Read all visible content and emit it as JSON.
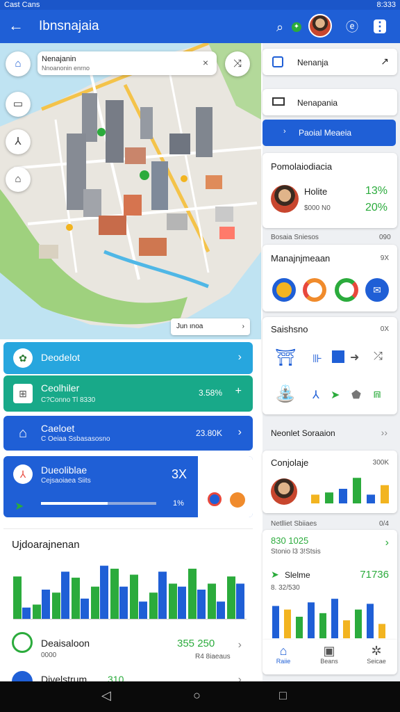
{
  "status_bar": {
    "carrier": "Cast Cans",
    "time": "8:333"
  },
  "app_bar": {
    "back_glyph": "←",
    "title": "Ibnsnajaia",
    "search_glyph": "⌕",
    "sync_glyph": "✦",
    "share_glyph": "ⓔ",
    "menu_glyph": "⋮"
  },
  "map": {
    "search": {
      "title": "Nenajanin",
      "subtitle": "Nnoanonin enrno",
      "close_glyph": "×"
    },
    "route_glyph": "⤨",
    "side_buttons": [
      "⌂",
      "▭",
      "⅄",
      "⌂"
    ],
    "scale": {
      "text": "Jun ınoa",
      "chevron": "›"
    }
  },
  "right_panel": {
    "dest1": "Nenanja",
    "dest2": "Nenapania",
    "primary_button": "Paoial Meaeia",
    "profile_card": {
      "title": "Pomolaiodiacia",
      "name": "Holite",
      "name_pct": "13%",
      "sub": "$000 N0",
      "sub_pct": "20%"
    },
    "section1": {
      "label": "Bosaia Sniesos",
      "value": "090"
    },
    "manage": {
      "title": "Manajnjmeaan",
      "badge": "9X"
    },
    "saisheno": {
      "title": "Saishsno",
      "badge": "0X"
    },
    "link_row": {
      "label": "Neonlet Soraaion",
      "chev": "››"
    },
    "conjolaje": {
      "title": "Conjolaje",
      "badge": "300K"
    },
    "stat_header": {
      "label": "Netlliet Sbiiaes",
      "value": "0/4"
    },
    "stat1": {
      "value": "830 1025",
      "sub": "Stonio l3 3!Stsis"
    },
    "stat2": {
      "label": "Slelme",
      "value": "71736",
      "sub": "8. 32/530"
    },
    "tabs": [
      {
        "glyph": "⌂",
        "label": "Raiie"
      },
      {
        "glyph": "▣",
        "label": "Beans"
      },
      {
        "glyph": "✲",
        "label": "Seicae"
      }
    ]
  },
  "drawer": {
    "item1": {
      "label": "Deodelot"
    },
    "item2": {
      "label": "Ceolhiler",
      "sub": "C?Conno Tl 8330",
      "value": "3.58%",
      "action": "+"
    },
    "item3": {
      "label": "Caeloet",
      "sub": "C Oeiaa Ssbasasosno",
      "value": "23.80K"
    },
    "item4": {
      "label": "Dueoliblae",
      "sub": "Cejsaoiaea Siits",
      "value": "3X",
      "progress_pct": "1%",
      "progress": 0.58
    }
  },
  "bottom": {
    "title": "Ujdoarajnenan",
    "row1": {
      "label": "Deaisaloon",
      "sub": "0000",
      "value": "355 250",
      "sub2": "R4 8iaeaus"
    },
    "row2": {
      "label": "Divelstrum",
      "value": "310"
    }
  },
  "chart_main": {
    "type": "bar",
    "series": [
      {
        "color": "#2bab3c",
        "values": [
          72,
          25,
          45,
          70,
          55,
          85,
          75,
          45,
          60,
          85,
          60,
          72
        ]
      },
      {
        "color": "#1f5fd6",
        "values": [
          20,
          50,
          80,
          35,
          90,
          55,
          30,
          80,
          55,
          50,
          30,
          60
        ]
      }
    ]
  },
  "chart_small": {
    "type": "bar",
    "values": [
      {
        "v": 12,
        "c": "#f2b420"
      },
      {
        "v": 15,
        "c": "#2bab3c"
      },
      {
        "v": 20,
        "c": "#1f5fd6"
      },
      {
        "v": 35,
        "c": "#2bab3c"
      },
      {
        "v": 12,
        "c": "#1f5fd6"
      },
      {
        "v": 25,
        "c": "#f2b420"
      }
    ]
  },
  "chart_bottom_right": {
    "type": "bar",
    "values": [
      {
        "v": 45,
        "c": "#1f5fd6"
      },
      {
        "v": 40,
        "c": "#f2b420"
      },
      {
        "v": 30,
        "c": "#2bab3c"
      },
      {
        "v": 50,
        "c": "#1f5fd6"
      },
      {
        "v": 35,
        "c": "#2bab3c"
      },
      {
        "v": 55,
        "c": "#1f5fd6"
      },
      {
        "v": 25,
        "c": "#f2b420"
      },
      {
        "v": 40,
        "c": "#2bab3c"
      },
      {
        "v": 48,
        "c": "#1f5fd6"
      },
      {
        "v": 20,
        "c": "#f2b420"
      }
    ]
  },
  "android_nav": {
    "back": "◁",
    "home": "○",
    "recents": "□"
  }
}
